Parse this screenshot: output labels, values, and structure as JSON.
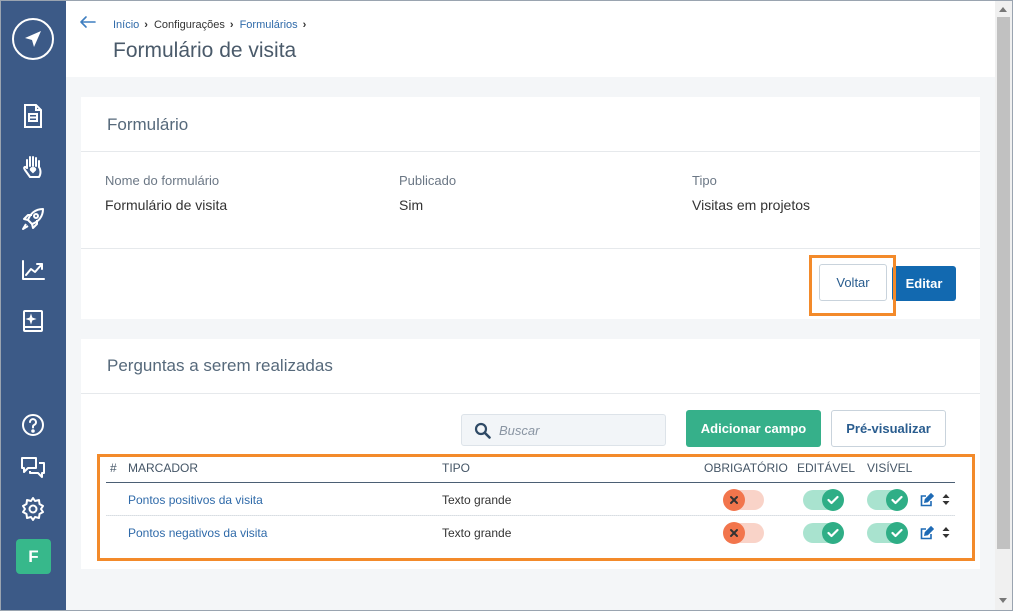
{
  "breadcrumb": {
    "items": [
      "Início",
      "Configurações",
      "Formulários"
    ]
  },
  "page_title": "Formulário de visita",
  "form_card": {
    "title": "Formulário",
    "fields": [
      {
        "label": "Nome do formulário",
        "value": "Formulário de visita"
      },
      {
        "label": "Publicado",
        "value": "Sim"
      },
      {
        "label": "Tipo",
        "value": "Visitas em projetos"
      }
    ],
    "back_label": "Voltar",
    "edit_label": "Editar"
  },
  "questions_card": {
    "title": "Perguntas a serem realizadas",
    "search_placeholder": "Buscar",
    "add_label": "Adicionar campo",
    "preview_label": "Pré-visualizar",
    "columns": [
      "#",
      "MARCADOR",
      "TIPO",
      "OBRIGATÓRIO",
      "EDITÁVEL",
      "VISÍVEL"
    ],
    "rows": [
      {
        "marker": "Pontos positivos da visita",
        "type": "Texto grande",
        "required": false,
        "editable": true,
        "visible": true
      },
      {
        "marker": "Pontos negativos da visita",
        "type": "Texto grande",
        "required": false,
        "editable": true,
        "visible": true
      }
    ]
  },
  "user": {
    "initial": "F"
  },
  "sidebar": {
    "icons": [
      "navigation-logo-icon",
      "document-icon",
      "hand-heart-icon",
      "rocket-icon",
      "trending-chart-icon",
      "sparkle-book-icon",
      "help-icon",
      "chat-icon",
      "settings-icon"
    ]
  },
  "colors": {
    "sidebar": "#3c5a87",
    "primary": "#1269b0",
    "green": "#36b08a",
    "highlight": "#f38a2a",
    "toggle_off": "#f2754c",
    "toggle_on": "#2fae86"
  }
}
